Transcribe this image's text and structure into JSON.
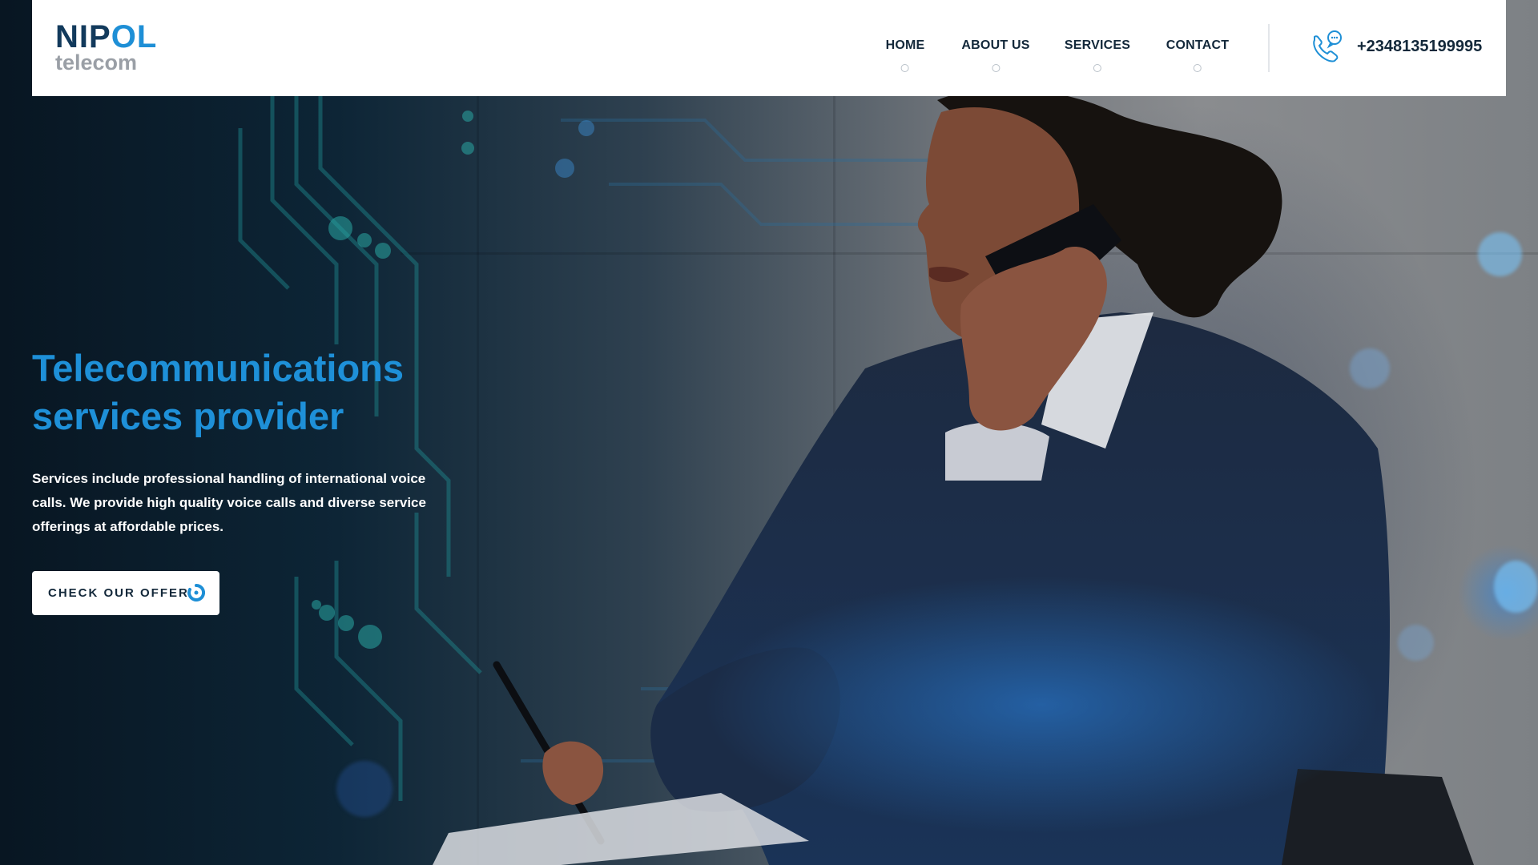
{
  "brand": {
    "logo_text_prefix": "NIP",
    "logo_text_accent": "O",
    "logo_text_suffix": "L",
    "logo_subtext": "telecom",
    "accent_color": "#1e8fd6",
    "dark_color": "#123a5c"
  },
  "nav": {
    "items": [
      {
        "label": "HOME"
      },
      {
        "label": "ABOUT US"
      },
      {
        "label": "SERVICES"
      },
      {
        "label": "CONTACT"
      }
    ]
  },
  "contact": {
    "phone": "+2348135199995",
    "icon": "phone-chat-icon"
  },
  "hero": {
    "title_line1": "Telecommunications",
    "title_line2": "services provider",
    "description": "Services include professional handling of international voice calls. We provide high quality voice calls and diverse service offerings at affordable prices.",
    "cta_label": "CHECK OUR OFFER",
    "cta_icon": "circular-arrow-icon",
    "title_color": "#1e90d8"
  }
}
